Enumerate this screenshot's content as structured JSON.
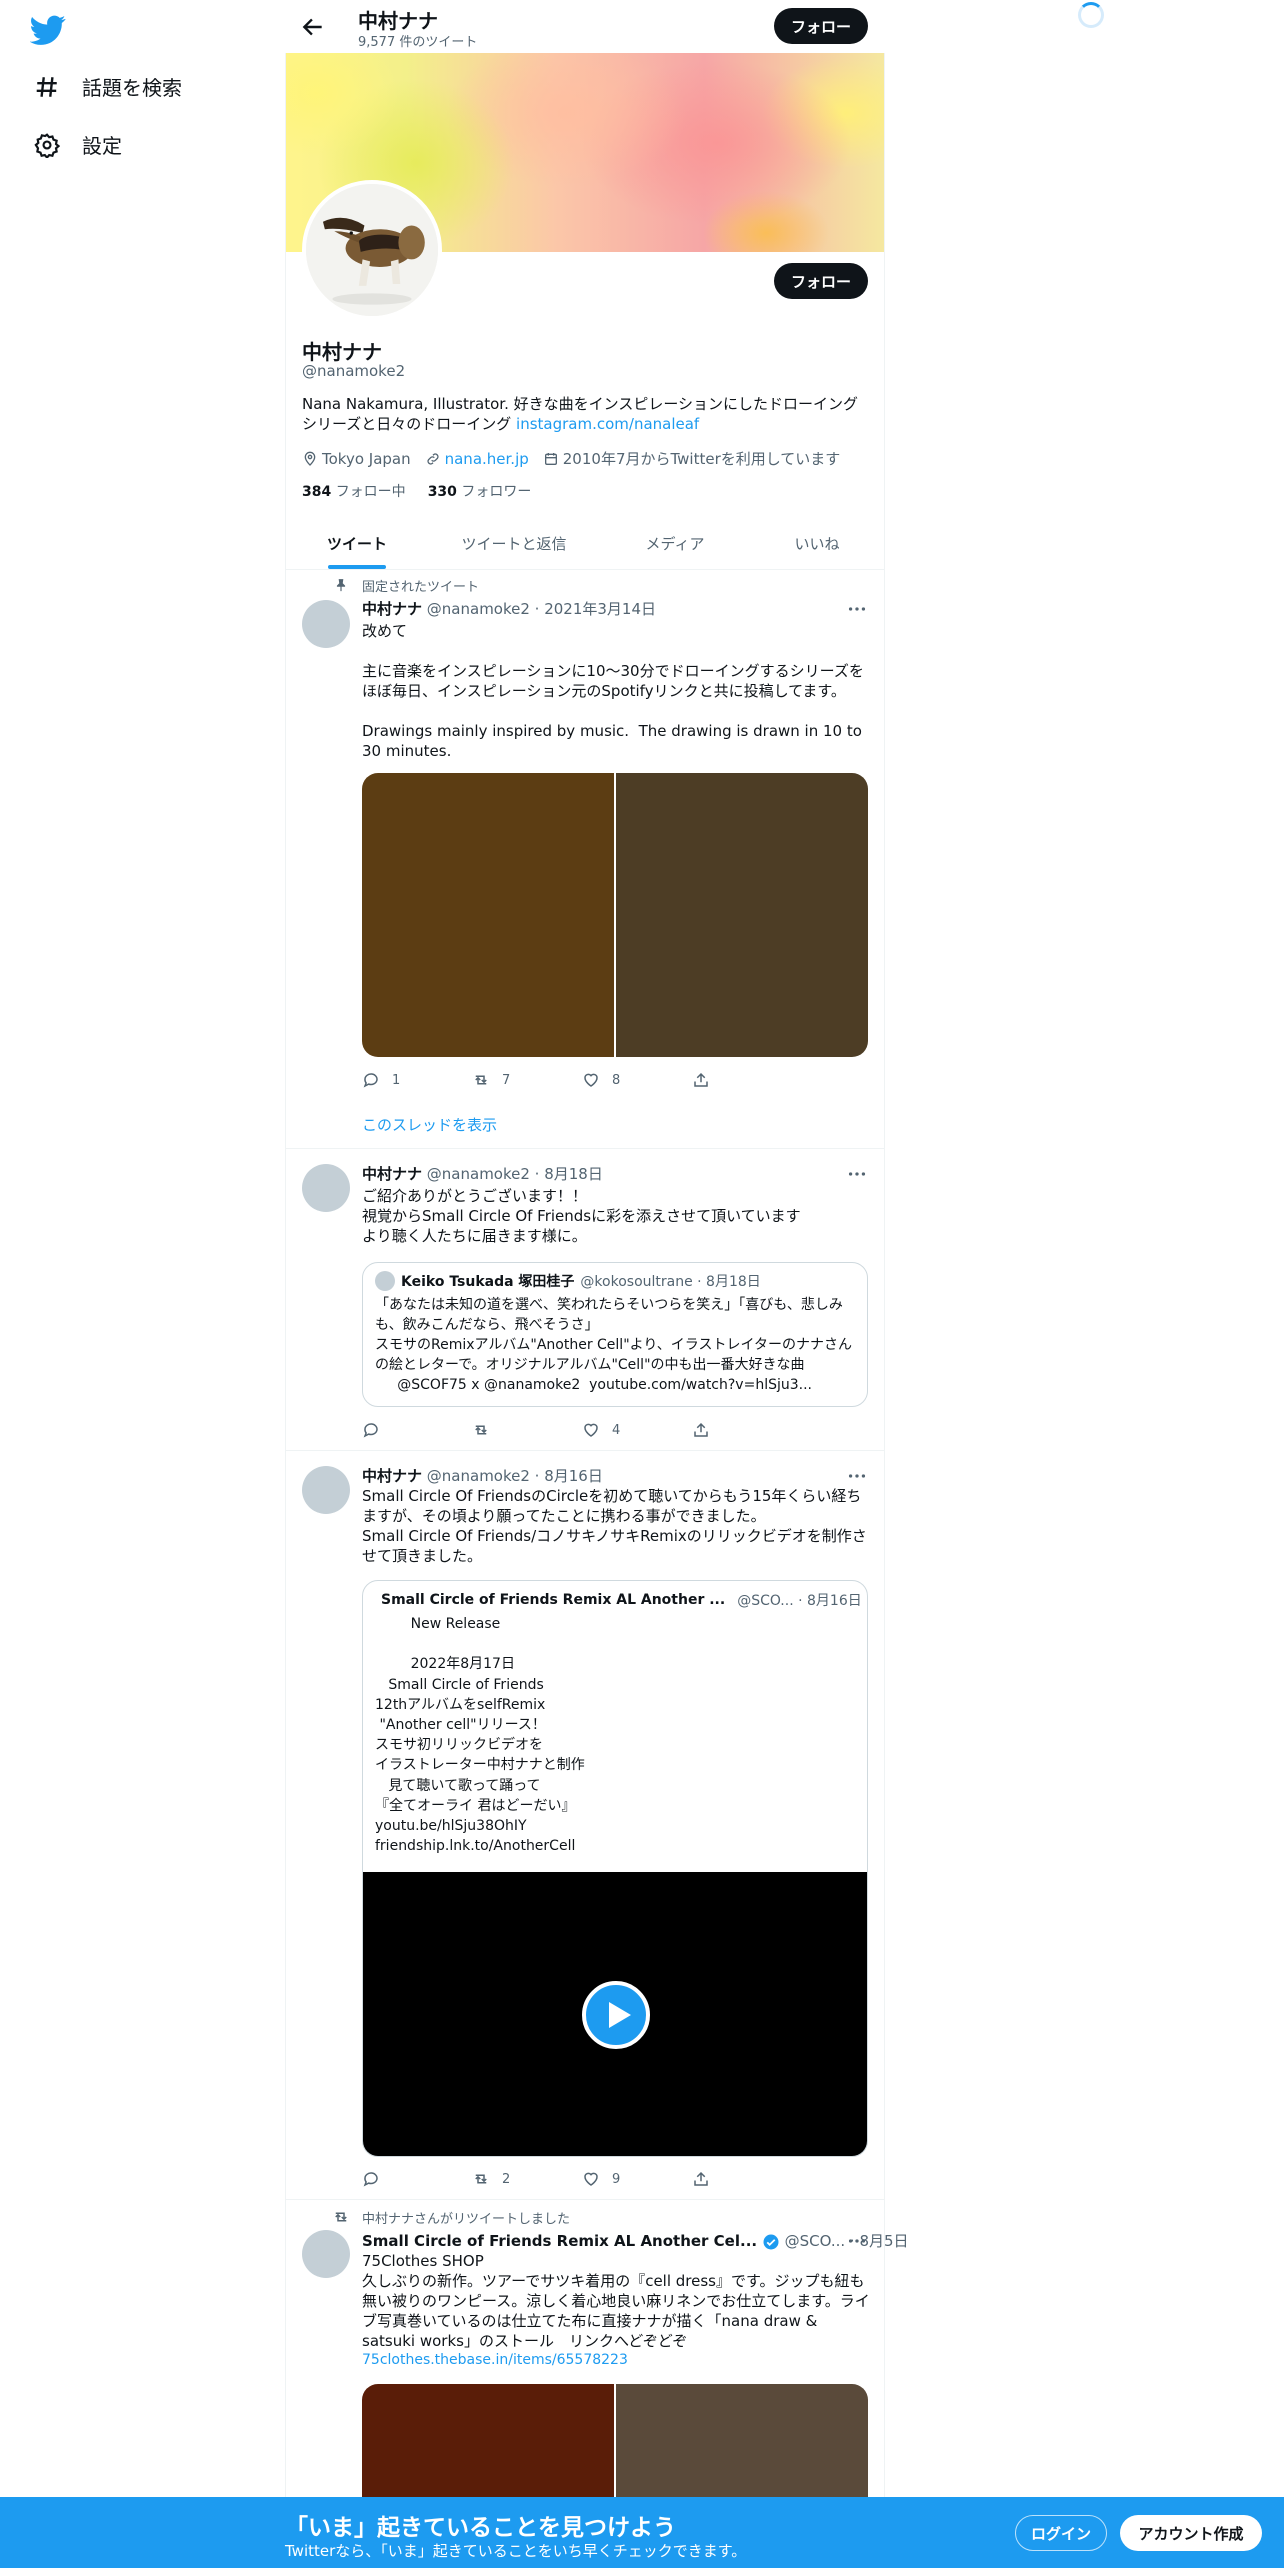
{
  "nav": {
    "explore_label": "話題を検索",
    "settings_label": "設定"
  },
  "header": {
    "name": "中村ナナ",
    "tweet_count": "9,577 件のツイート",
    "follow_label": "フォロー"
  },
  "profile": {
    "name": "中村ナナ",
    "handle": "@nanamoke2",
    "follow_label": "フォロー",
    "bio_text": "Nana Nakamura, Illustrator. 好きな曲をインスピレーションにしたドローイングシリーズと日々のドローイング ",
    "bio_link": "instagram.com/nanaleaf",
    "location": "Tokyo Japan",
    "website": "nana.her.jp",
    "joined": "2010年7月からTwitterを利用しています",
    "following_count": "384",
    "following_label": "フォロー中",
    "followers_count": "330",
    "followers_label": "フォロワー"
  },
  "tabs": [
    "ツイート",
    "ツイートと返信",
    "メディア",
    "いいね"
  ],
  "tweets": [
    {
      "context": "固定されたツイート",
      "name": "中村ナナ",
      "meta": "@nanamoke2 · 2021年3月14日",
      "text": "改めて\n\n主に音楽をインスピレーションに10〜30分でドローイングするシリーズをほぼ毎日、インスピレーション元のSpotifyリンクと共に投稿してます。\n\nDrawings mainly inspired by music.  The drawing is drawn in 10 to 30 minutes.",
      "media_colors": [
        "#5c3d13",
        "#4d3d25"
      ],
      "replies": "1",
      "retweets": "7",
      "likes": "8",
      "thread_link": "このスレッドを表示"
    },
    {
      "name": "中村ナナ",
      "meta": "@nanamoke2 · 8月18日",
      "text": "ご紹介ありがとうございます！！\n視覚からSmall Circle Of Friendsに彩を添えさせて頂いています\nより聴く人たちに届きます様に。",
      "quote": {
        "name": "Keiko Tsukada 塚田桂子",
        "meta": "@kokosoultrane · 8月18日",
        "text": "「あなたは未知の道を選べ、笑われたらそいつらを笑え」「喜びも、悲しみも、飲みこんだなら、飛べそうさ」\nスモサのRemixアルバム\"Another Cell\"より、イラストレイターのナナさんの絵とレターで。オリジナルアルバム\"Cell\"の中も出一番大好きな曲\n     @SCOF75 x @nanamoke2  youtube.com/watch?v=hlSju3..."
      },
      "replies": "",
      "retweets": "",
      "likes": "4"
    },
    {
      "name": "中村ナナ",
      "meta": "@nanamoke2 · 8月16日",
      "text": "Small Circle Of FriendsのCircleを初めて聴いてからもう15年くらい経ちますが、その頃より願ってたことに携わる事ができました。\nSmall Circle Of Friends/コノサキノサキRemixのリリックビデオを制作させて頂きました。",
      "quote": {
        "name": "Small Circle of Friends Remix AL Another ...",
        "meta": "@SCO... · 8月16日",
        "text": "        New Release\n\n        2022年8月17日\n   Small Circle of Friends\n12thアルバムをselfRemix\n \"Another cell\"リリース！\nスモサ初リリックビデオを\nイラストレーター中村ナナと制作\n   見て聴いて歌って踊って\n『全てオーライ 君はどーだい』\nyoutu.be/hlSju38OhIY\nfriendship.lnk.to/AnotherCell"
      },
      "replies": "",
      "retweets": "2",
      "likes": "9"
    },
    {
      "context": "中村ナナさんがリツイートしました",
      "name": "Small Circle of Friends Remix AL Another Cel...",
      "meta": "@SCO... · 8月5日",
      "text": "75Clothes SHOP\n久しぶりの新作。ツアーでサツキ着用の『cell dress』です。ジップも紐も無い被りのワンピース。涼しく着心地良い麻リネンでお仕立てします。ライブ写真巻いているのは仕立てた布に直接ナナが描く「nana draw & satsuki works」のストール　リンクへどぞどぞ",
      "link": "75clothes.thebase.in/items/65578223",
      "media_colors": [
        "#5a1d08",
        "#5a4a3a"
      ]
    }
  ],
  "bottom_bar": {
    "title": "「いま」起きていることを見つけよう",
    "subtitle": "Twitterなら、「いま」起きていることをいち早くチェックできます。",
    "login_label": "ログイン",
    "signup_label": "アカウント作成"
  },
  "colors": {
    "accent": "#1d9bf0",
    "text": "#0f1419",
    "muted": "#536471"
  }
}
